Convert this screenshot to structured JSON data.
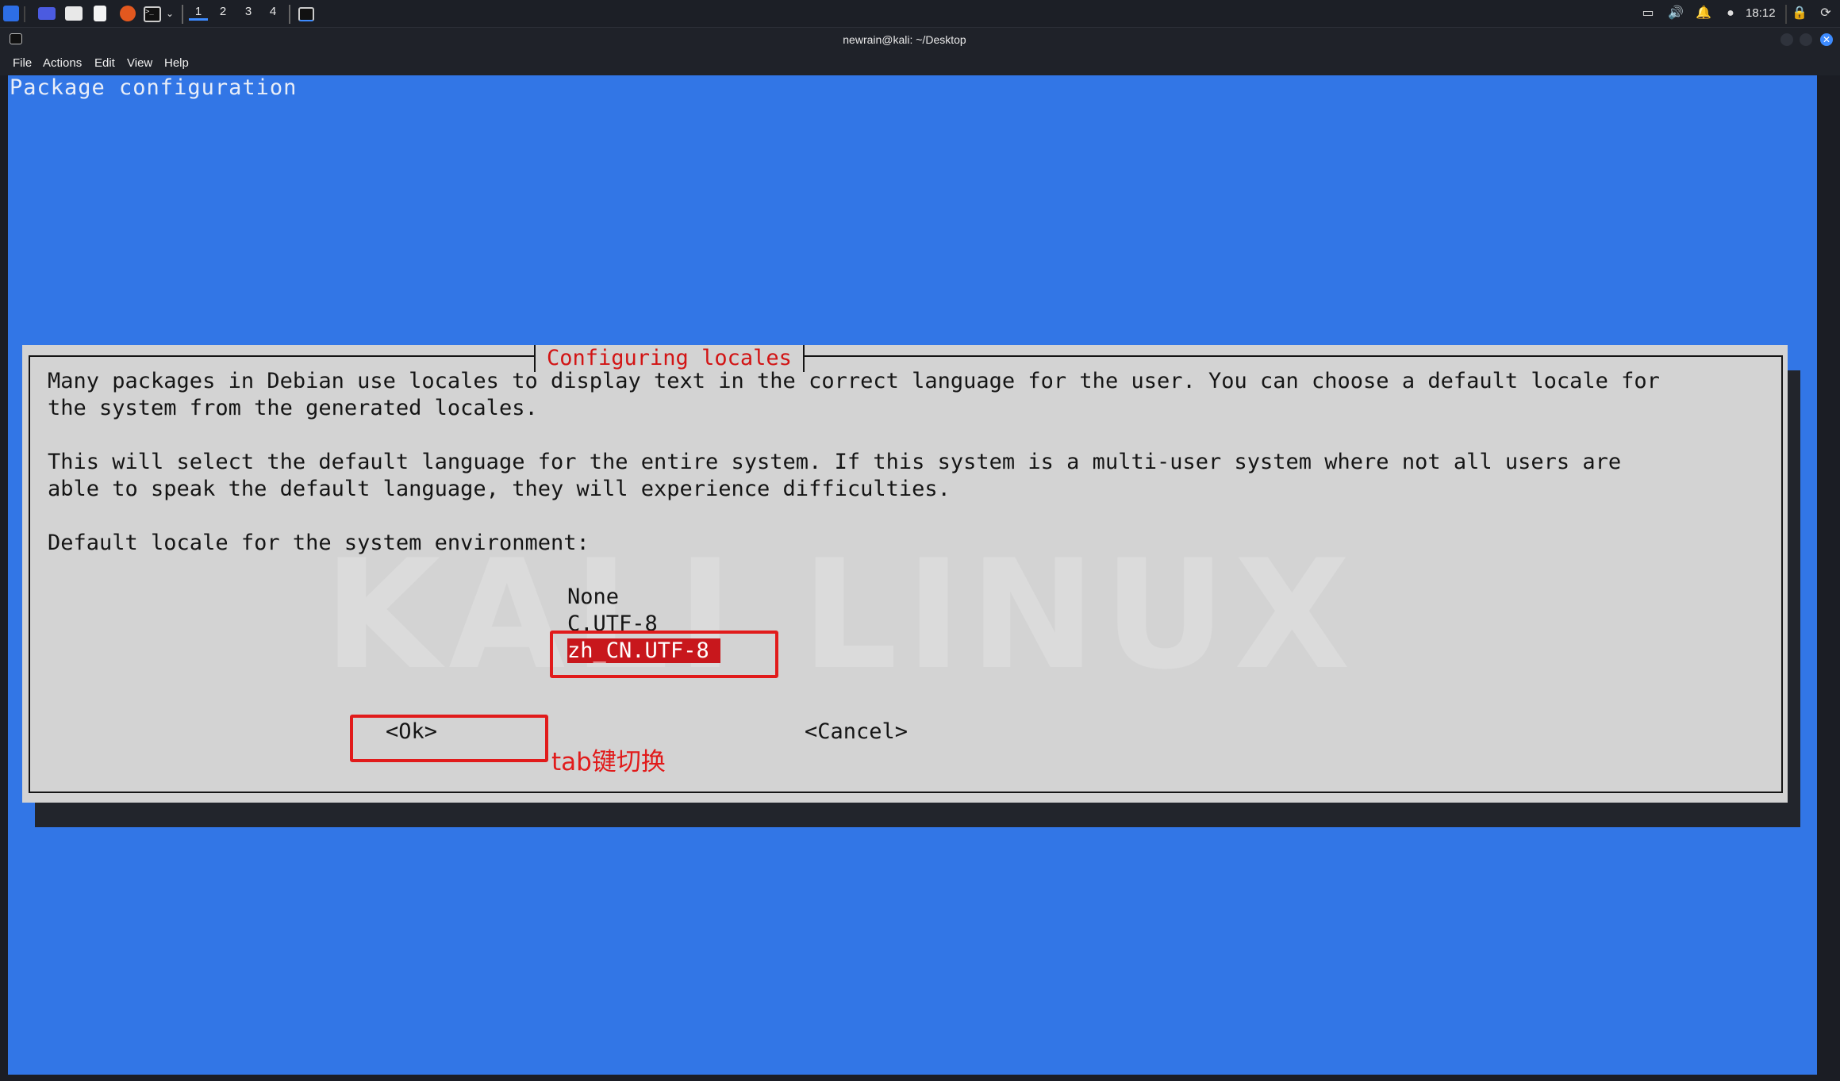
{
  "taskbar": {
    "workspaces": [
      "1",
      "2",
      "3",
      "4"
    ],
    "clock": "18:12",
    "launcher_icons": [
      "kali-menu-icon",
      "desktop-icon",
      "files-icon",
      "text-editor-icon",
      "firefox-icon",
      "terminal-icon"
    ]
  },
  "window": {
    "title": "newrain@kali: ~/Desktop"
  },
  "menubar": {
    "items": [
      "File",
      "Actions",
      "Edit",
      "View",
      "Help"
    ]
  },
  "terminal": {
    "header": "Package configuration",
    "dialog": {
      "title": "Configuring locales",
      "paragraph1_line1": "Many packages in Debian use locales to display text in the correct language for the user. You can choose a default locale for",
      "paragraph1_line2": "the system from the generated locales.",
      "paragraph2_line1": "This will select the default language for the entire system. If this system is a multi-user system where not all users are",
      "paragraph2_line2": "able to speak the default language, they will experience difficulties.",
      "prompt": "Default locale for the system environment:",
      "options": [
        "None",
        "C.UTF-8",
        "zh_CN.UTF-8"
      ],
      "selected_option": "zh_CN.UTF-8",
      "ok_button": "<Ok>",
      "cancel_button": "<Cancel>"
    }
  },
  "annotation": {
    "text": "tab键切换",
    "color": "#e11b1b"
  },
  "colors": {
    "terminal_bg": "#3276e6",
    "dialog_bg": "#d3d3d3",
    "dialog_title": "#d21414",
    "selection_bg": "#c8171c"
  }
}
